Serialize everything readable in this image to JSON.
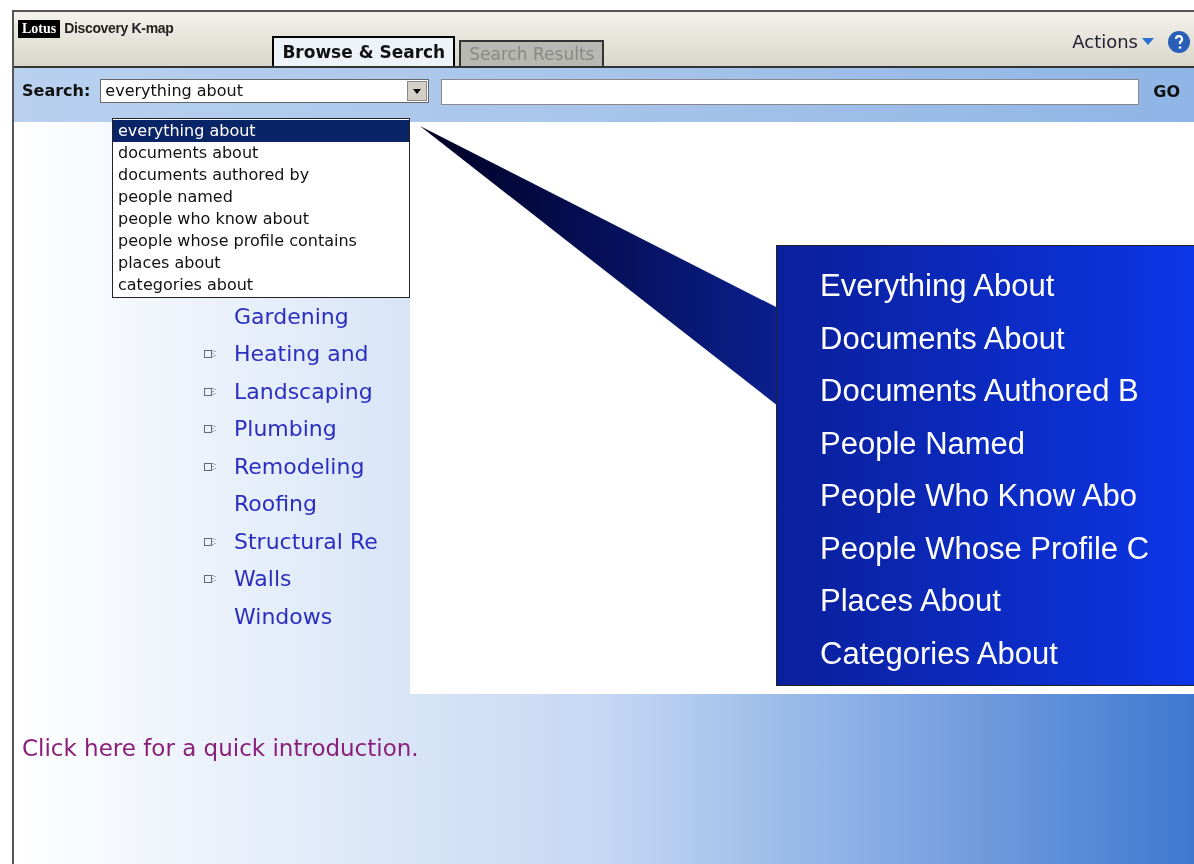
{
  "header": {
    "logo": "Lotus",
    "title": "Discovery K-map",
    "actions": "Actions"
  },
  "tabs": [
    {
      "label": "Browse & Search",
      "selected": true
    },
    {
      "label": "Search Results",
      "selected": false
    }
  ],
  "search": {
    "label": "Search:",
    "select_value": "everything about",
    "go": "GO",
    "options": [
      {
        "label": "everything about",
        "selected": true
      },
      {
        "label": "documents about",
        "selected": false
      },
      {
        "label": "documents authored by",
        "selected": false
      },
      {
        "label": "people named",
        "selected": false
      },
      {
        "label": "people who know about",
        "selected": false
      },
      {
        "label": "people whose profile contains",
        "selected": false
      },
      {
        "label": "places about",
        "selected": false
      },
      {
        "label": "categories about",
        "selected": false
      }
    ]
  },
  "tree": [
    {
      "label": "Gardening",
      "has_children": false
    },
    {
      "label": "Heating and",
      "has_children": true
    },
    {
      "label": "Landscaping",
      "has_children": true
    },
    {
      "label": "Plumbing",
      "has_children": true
    },
    {
      "label": "Remodeling",
      "has_children": true
    },
    {
      "label": "Roofing",
      "has_children": false
    },
    {
      "label": "Structural Re",
      "has_children": true
    },
    {
      "label": "Walls",
      "has_children": true
    },
    {
      "label": "Windows",
      "has_children": false
    }
  ],
  "callout": [
    "Everything About",
    "Documents About",
    "Documents Authored B",
    "People Named",
    "People Who Know Abo",
    "People Whose Profile C",
    "Places About",
    "Categories About"
  ],
  "intro_link": "Click here for a quick introduction."
}
